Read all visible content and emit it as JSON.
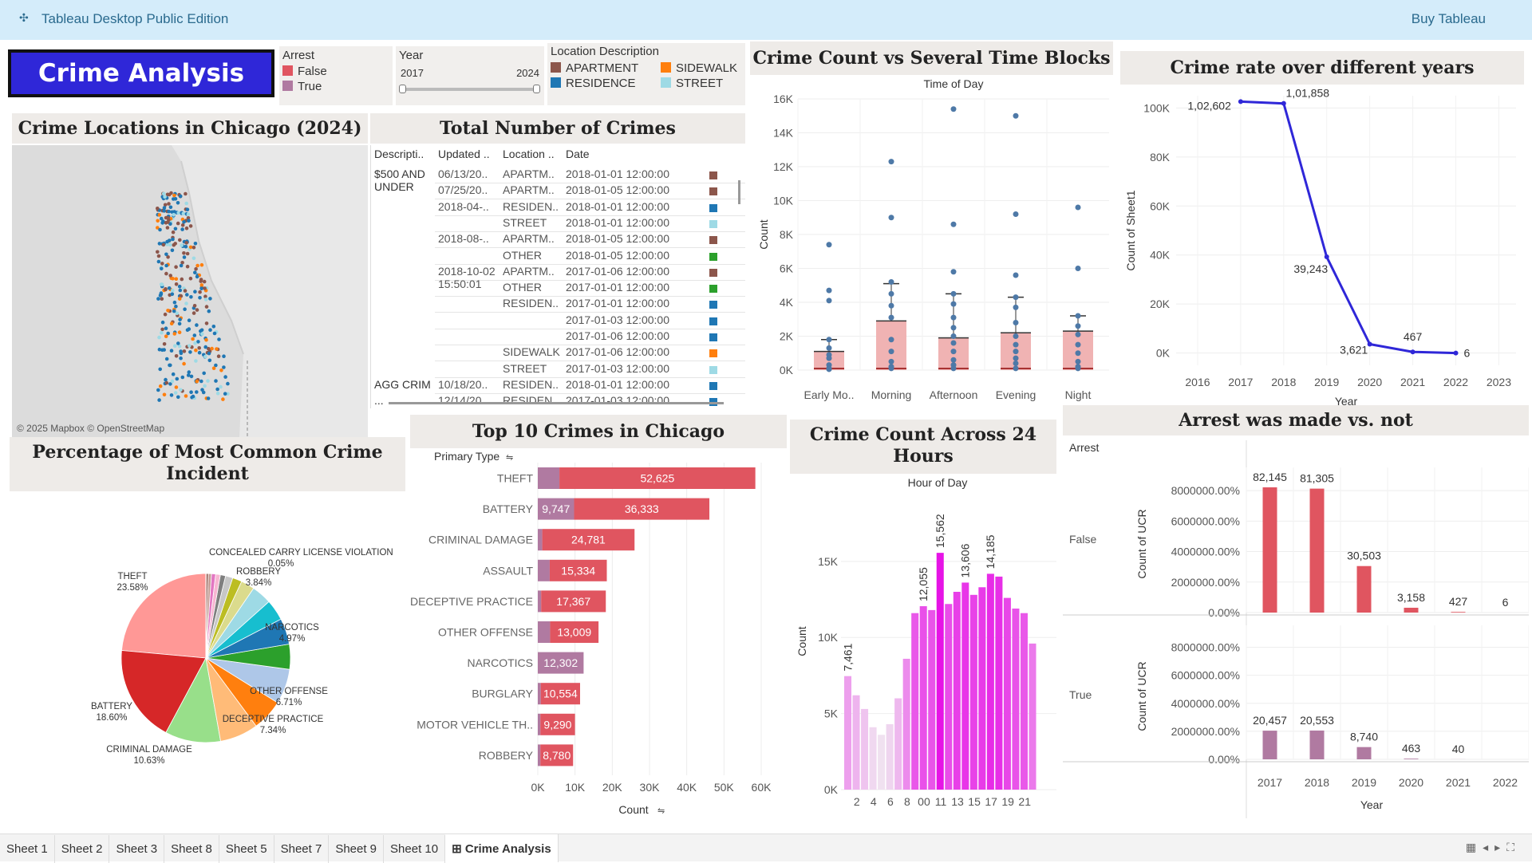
{
  "app": {
    "title": "Tableau Desktop Public Edition",
    "buy": "Buy Tableau"
  },
  "dashboard_title": "Crime Analysis",
  "filters": {
    "arrest": {
      "label": "Arrest",
      "items": [
        {
          "label": "False",
          "color": "#e05560"
        },
        {
          "label": "True",
          "color": "#b07aa1"
        }
      ]
    },
    "year": {
      "label": "Year",
      "min": "2017",
      "max": "2024"
    },
    "location": {
      "label": "Location Description",
      "items": [
        {
          "label": "APARTMENT",
          "color": "#8c564b"
        },
        {
          "label": "SIDEWALK",
          "color": "#ff7f0e"
        },
        {
          "label": "RESIDENCE",
          "color": "#1f77b4"
        },
        {
          "label": "STREET",
          "color": "#9edae5"
        }
      ]
    }
  },
  "map": {
    "title": "Crime Locations in Chicago (2024)",
    "attribution": "© 2025 Mapbox © OpenStreetMap"
  },
  "table": {
    "title": "Total Number of Crimes",
    "headers": [
      "Descripti..",
      "Updated ..",
      "Location ..",
      "Date"
    ],
    "desc_groups": [
      {
        "text": "$500 AND UNDER",
        "row": 0
      },
      {
        "text": "AGG CRIM",
        "row": 13
      },
      {
        "text": "...",
        "row": 14
      }
    ],
    "updated_groups": [
      {
        "text": "06/13/20..",
        "row": 0
      },
      {
        "text": "07/25/20..",
        "row": 1
      },
      {
        "text": "2018-04-..",
        "row": 2
      },
      {
        "text": "2018-08-..",
        "row": 4
      },
      {
        "text": "2018-10-02 15:50:01",
        "row": 6
      },
      {
        "text": "10/18/20..",
        "row": 13
      },
      {
        "text": "12/14/20..",
        "row": 14
      }
    ],
    "rows": [
      {
        "loc": "APARTM..",
        "date": "2018-01-01 12:00:00",
        "color": "#8c564b"
      },
      {
        "loc": "APARTM..",
        "date": "2018-01-05 12:00:00",
        "color": "#8c564b"
      },
      {
        "loc": "RESIDEN..",
        "date": "2018-01-01 12:00:00",
        "color": "#1f77b4"
      },
      {
        "loc": "STREET",
        "date": "2018-01-01 12:00:00",
        "color": "#9edae5"
      },
      {
        "loc": "APARTM..",
        "date": "2018-01-05 12:00:00",
        "color": "#8c564b"
      },
      {
        "loc": "OTHER",
        "date": "2018-01-05 12:00:00",
        "color": "#2ca02c"
      },
      {
        "loc": "APARTM..",
        "date": "2017-01-06 12:00:00",
        "color": "#8c564b"
      },
      {
        "loc": "OTHER",
        "date": "2017-01-01 12:00:00",
        "color": "#2ca02c"
      },
      {
        "loc": "RESIDEN..",
        "date": "2017-01-01 12:00:00",
        "color": "#1f77b4"
      },
      {
        "loc": "",
        "date": "2017-01-03 12:00:00",
        "color": "#1f77b4"
      },
      {
        "loc": "",
        "date": "2017-01-06 12:00:00",
        "color": "#1f77b4"
      },
      {
        "loc": "SIDEWALK",
        "date": "2017-01-06 12:00:00",
        "color": "#ff7f0e"
      },
      {
        "loc": "STREET",
        "date": "2017-01-03 12:00:00",
        "color": "#9edae5"
      },
      {
        "loc": "RESIDEN..",
        "date": "2018-01-01 12:00:00",
        "color": "#1f77b4"
      },
      {
        "loc": "RESIDEN..",
        "date": "2017-01-03 12:00:00",
        "color": "#1f77b4"
      }
    ]
  },
  "pie_title": "Percentage of Most Common Crime Incident",
  "top10_title": "Top 10 Crimes in Chicago",
  "timeblocks_title": "Crime Count vs Several Time Blocks",
  "hours_title": "Crime Count Across 24 Hours",
  "years_title": "Crime rate over different years",
  "arrest_title": "Arrest was made vs. not",
  "tabs": [
    "Sheet 1",
    "Sheet 2",
    "Sheet 3",
    "Sheet 8",
    "Sheet 5",
    "Sheet 7",
    "Sheet 9",
    "Sheet 10",
    "Crime Analysis"
  ],
  "chart_data": [
    {
      "id": "pie",
      "type": "pie",
      "slices": [
        {
          "label": "THEFT",
          "value": 23.58,
          "pct_label": "23.58%",
          "color": "#ff9896",
          "show": true
        },
        {
          "label": "BATTERY",
          "value": 18.6,
          "pct_label": "18.60%",
          "color": "#d62728",
          "show": true
        },
        {
          "label": "CRIMINAL DAMAGE",
          "value": 10.63,
          "pct_label": "10.63%",
          "color": "#98df8a",
          "show": true
        },
        {
          "label": "DECEPTIVE PRACTICE",
          "value": 7.34,
          "pct_label": "7.34%",
          "color": "#ffbb78",
          "show": true
        },
        {
          "label": "",
          "value": 6.0,
          "pct_label": "",
          "color": "#ff7f0e",
          "show": false
        },
        {
          "label": "OTHER OFFENSE",
          "value": 6.71,
          "pct_label": "6.71%",
          "color": "#aec7e8",
          "show": true
        },
        {
          "label": "",
          "value": 4.8,
          "pct_label": "",
          "color": "#2ca02c",
          "show": false
        },
        {
          "label": "NARCOTICS",
          "value": 4.97,
          "pct_label": "4.97%",
          "color": "#1f77b4",
          "show": true
        },
        {
          "label": "",
          "value": 4.0,
          "pct_label": "",
          "color": "#17becf",
          "show": false
        },
        {
          "label": "ROBBERY",
          "value": 3.84,
          "pct_label": "3.84%",
          "color": "#9edae5",
          "show": true
        },
        {
          "label": "",
          "value": 2.6,
          "pct_label": "",
          "color": "#dbdb8d",
          "show": false
        },
        {
          "label": "",
          "value": 1.8,
          "pct_label": "",
          "color": "#bcbd22",
          "show": false
        },
        {
          "label": "",
          "value": 1.4,
          "pct_label": "",
          "color": "#c7c7c7",
          "show": false
        },
        {
          "label": "",
          "value": 1.0,
          "pct_label": "",
          "color": "#7f7f7f",
          "show": false
        },
        {
          "label": "",
          "value": 0.9,
          "pct_label": "",
          "color": "#f7b6d2",
          "show": false
        },
        {
          "label": "",
          "value": 0.8,
          "pct_label": "",
          "color": "#e377c2",
          "show": false
        },
        {
          "label": "",
          "value": 0.6,
          "pct_label": "",
          "color": "#c49c94",
          "show": false
        },
        {
          "label": "",
          "value": 0.4,
          "pct_label": "",
          "color": "#8c564b",
          "show": false
        },
        {
          "label": "CONCEALED CARRY LICENSE VIOLATION",
          "value": 0.05,
          "pct_label": "0.05%",
          "color": "#9467bd",
          "show": true
        }
      ]
    },
    {
      "id": "top10",
      "type": "bar",
      "ylabel": "Primary Type",
      "xlabel": "Count",
      "xlim": [
        0,
        60000
      ],
      "ticks": [
        "0K",
        "10K",
        "20K",
        "30K",
        "40K",
        "50K",
        "60K"
      ],
      "categories": [
        "THEFT",
        "BATTERY",
        "CRIMINAL DAMAGE",
        "ASSAULT",
        "DECEPTIVE PRACTICE",
        "OTHER OFFENSE",
        "NARCOTICS",
        "BURGLARY",
        "MOTOR VEHICLE TH..",
        "ROBBERY"
      ],
      "series": [
        {
          "name": "True",
          "color": "#b07aa1",
          "values": [
            5800,
            9747,
            1200,
            3200,
            900,
            3300,
            12302,
            800,
            700,
            700
          ]
        },
        {
          "name": "False",
          "color": "#e05560",
          "values": [
            52625,
            36333,
            24781,
            15334,
            17367,
            13009,
            0,
            10554,
            9290,
            8780
          ]
        }
      ],
      "labels": [
        [
          null,
          "52,625"
        ],
        [
          "9,747",
          "36,333"
        ],
        [
          null,
          "24,781"
        ],
        [
          null,
          "15,334"
        ],
        [
          null,
          "17,367"
        ],
        [
          null,
          "13,009"
        ],
        [
          "12,302",
          null
        ],
        [
          null,
          "10,554"
        ],
        [
          null,
          "9,290"
        ],
        [
          null,
          "8,780"
        ]
      ]
    },
    {
      "id": "timeblocks",
      "type": "scatter",
      "header": "Time of Day",
      "ylabel": "Count",
      "ylim": [
        0,
        16000
      ],
      "ticks": [
        "0K",
        "2K",
        "4K",
        "6K",
        "8K",
        "10K",
        "12K",
        "14K",
        "16K"
      ],
      "categories": [
        "Early Mo..",
        "Morning",
        "Afternoon",
        "Evening",
        "Night"
      ],
      "boxes": [
        {
          "low": 0,
          "q3": 1100,
          "whisker": 1800
        },
        {
          "low": 0,
          "q3": 2900,
          "whisker": 5100
        },
        {
          "low": 0,
          "q3": 1900,
          "whisker": 4500
        },
        {
          "low": 0,
          "q3": 2200,
          "whisker": 4300
        },
        {
          "low": 0,
          "q3": 2300,
          "whisker": 3200
        }
      ],
      "points": [
        [
          7400,
          4700,
          4100,
          1800,
          1300,
          900,
          700,
          300,
          100,
          50
        ],
        [
          12300,
          9000,
          5200,
          4500,
          3800,
          3100,
          1800,
          1100,
          500,
          200,
          100
        ],
        [
          15400,
          8600,
          5800,
          4500,
          3900,
          3100,
          2500,
          2000,
          1600,
          1100,
          600,
          300,
          100
        ],
        [
          15000,
          9200,
          5600,
          4300,
          3700,
          2800,
          2000,
          1500,
          1100,
          700,
          400,
          100
        ],
        [
          9600,
          6000,
          3200,
          2600,
          2100,
          1500,
          1000,
          500,
          200,
          100
        ]
      ]
    },
    {
      "id": "hours",
      "type": "bar",
      "header": "Hour of Day",
      "ylabel": "Count",
      "ylim": [
        0,
        19500
      ],
      "ticks": [
        "0K",
        "5K",
        "10K",
        "15K"
      ],
      "x_tick_labels": [
        "2",
        "4",
        "6",
        "8",
        "00",
        "11",
        "13",
        "15",
        "17",
        "19",
        "21"
      ],
      "values": [
        7461,
        6200,
        5300,
        4100,
        3600,
        4300,
        6000,
        8600,
        11600,
        12055,
        11800,
        15562,
        12200,
        13000,
        13606,
        12800,
        13300,
        14185,
        14000,
        12600,
        11900,
        11600,
        9600
      ],
      "labels": {
        "0": "7,461",
        "9": "12,055",
        "11": "15,562",
        "14": "13,606",
        "17": "14,185"
      }
    },
    {
      "id": "years",
      "type": "line",
      "ylabel": "Count of Sheet1",
      "xlabel": "Year",
      "ylim": [
        -5000,
        105000
      ],
      "ticks": [
        "0K",
        "20K",
        "40K",
        "60K",
        "80K",
        "100K"
      ],
      "x_ticks": [
        "2016",
        "2017",
        "2018",
        "2019",
        "2020",
        "2021",
        "2022",
        "2023"
      ],
      "x": [
        2017,
        2018,
        2019,
        2020,
        2021,
        2022
      ],
      "values": [
        102602,
        101858,
        39243,
        3621,
        467,
        6
      ],
      "labels": [
        "1,02,602",
        "1,01,858",
        "39,243",
        "3,621",
        "467",
        "6"
      ]
    },
    {
      "id": "arrest",
      "type": "bar",
      "header": "Arrest",
      "ylabel": "Count of UCR",
      "xlabel": "Year",
      "x_ticks": [
        "2017",
        "2018",
        "2019",
        "2020",
        "2021",
        "2022"
      ],
      "ticks": [
        "0.00%",
        "2000000.00%",
        "4000000.00%",
        "6000000.00%",
        "8000000.00%"
      ],
      "ylim": [
        0,
        9000000
      ],
      "series": [
        {
          "name": "False",
          "color": "#e05560",
          "values": [
            82145,
            81305,
            30503,
            3158,
            427,
            6
          ],
          "labels": [
            "82,145",
            "81,305",
            "30,503",
            "3,158",
            "427",
            "6"
          ]
        },
        {
          "name": "True",
          "color": "#b07aa1",
          "values": [
            20457,
            20553,
            8740,
            463,
            40,
            0
          ],
          "labels": [
            "20,457",
            "20,553",
            "8,740",
            "463",
            "40",
            ""
          ]
        }
      ]
    }
  ]
}
